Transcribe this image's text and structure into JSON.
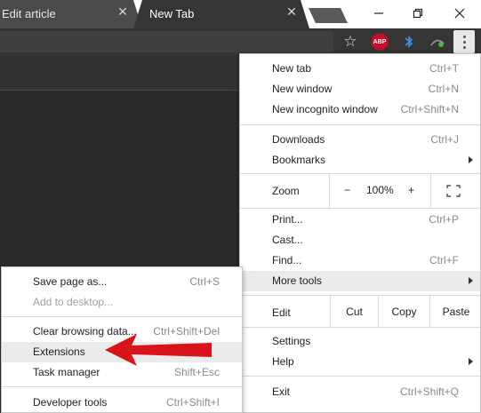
{
  "tabs": [
    {
      "title": "Edit article",
      "close": "✕"
    },
    {
      "title": "New Tab",
      "close": "✕"
    }
  ],
  "window_controls": {
    "minimize": "—",
    "maximize": "❐",
    "close": "✕"
  },
  "toolbar": {
    "star": "☆",
    "abp": "ABP"
  },
  "main_menu": {
    "items": [
      {
        "label": "New tab",
        "shortcut": "Ctrl+T"
      },
      {
        "label": "New window",
        "shortcut": "Ctrl+N"
      },
      {
        "label": "New incognito window",
        "shortcut": "Ctrl+Shift+N"
      },
      {
        "label": "Downloads",
        "shortcut": "Ctrl+J"
      },
      {
        "label": "Bookmarks",
        "shortcut": ""
      },
      {
        "label": "Print...",
        "shortcut": "Ctrl+P"
      },
      {
        "label": "Cast...",
        "shortcut": ""
      },
      {
        "label": "Find...",
        "shortcut": "Ctrl+F"
      },
      {
        "label": "More tools",
        "shortcut": ""
      },
      {
        "label": "Settings",
        "shortcut": ""
      },
      {
        "label": "Help",
        "shortcut": ""
      },
      {
        "label": "Exit",
        "shortcut": "Ctrl+Shift+Q"
      }
    ],
    "zoom": {
      "label": "Zoom",
      "minus": "−",
      "value": "100%",
      "plus": "+"
    },
    "edit": {
      "label": "Edit",
      "cut": "Cut",
      "copy": "Copy",
      "paste": "Paste"
    }
  },
  "sub_menu": {
    "items": [
      {
        "label": "Save page as...",
        "shortcut": "Ctrl+S"
      },
      {
        "label": "Add to desktop...",
        "shortcut": ""
      },
      {
        "label": "Clear browsing data...",
        "shortcut": "Ctrl+Shift+Del"
      },
      {
        "label": "Extensions",
        "shortcut": ""
      },
      {
        "label": "Task manager",
        "shortcut": "Shift+Esc"
      },
      {
        "label": "Developer tools",
        "shortcut": "Ctrl+Shift+I"
      }
    ]
  },
  "colors": {
    "highlight": "#ebebeb",
    "arrow": "#d8141a",
    "abp": "#c70d2c"
  }
}
